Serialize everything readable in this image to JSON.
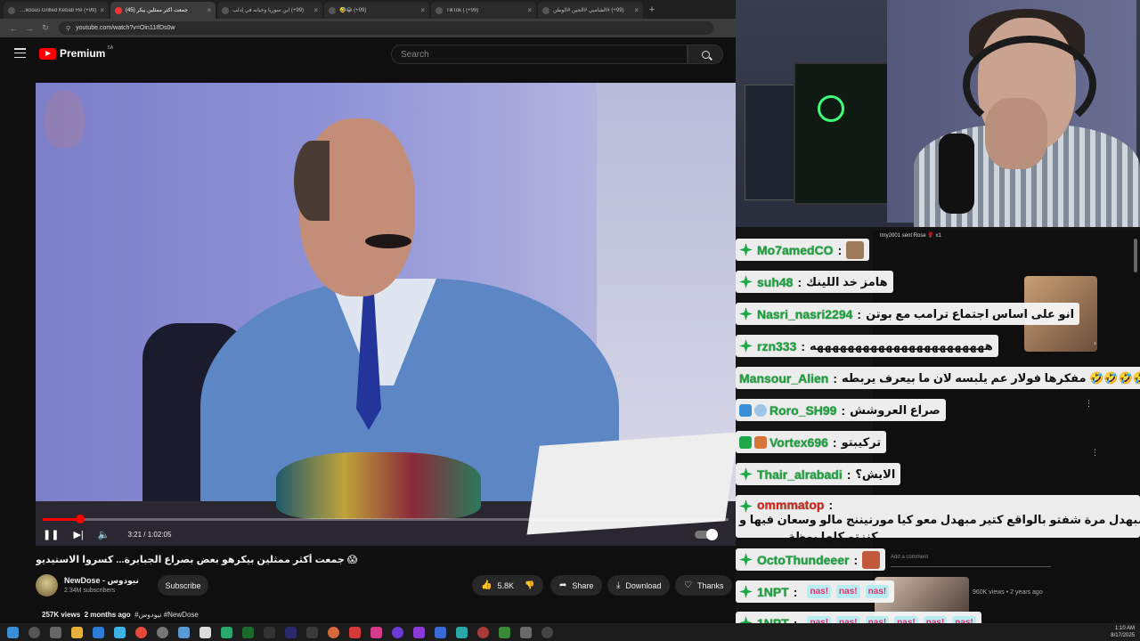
{
  "browser": {
    "tabs": [
      {
        "label": "(99+) Delicious Grilled Kebab Re",
        "active": false
      },
      {
        "label": "جمعت أكثر ممثلين بيكر (45)",
        "active": true
      },
      {
        "label": "(99+) ابن سوريا وخيانه في إدلب",
        "active": false
      },
      {
        "label": "(99+) 😂🤣",
        "active": false
      },
      {
        "label": "(99+) | TikTok",
        "active": false
      },
      {
        "label": "(99+) #الشاميي #الجين #الوطن",
        "active": false
      }
    ],
    "new_tab": "+",
    "url": "youtube.com/watch?v=Oin11IfDs0w"
  },
  "youtube": {
    "logo_text": "Premium",
    "region": "SA",
    "search_placeholder": "Search",
    "player": {
      "current_time": "3:21",
      "duration": "1:02:05",
      "time_display": "3:21 / 1:02:05",
      "progress": 0.054
    },
    "video_title": "جمعت أكثر ممثلين بيكرهو بعض بصراع الجبابرة... كسروا الاستيديو 😱",
    "channel": {
      "name": "NewDose - نيودوس",
      "subscribers": "2.34M subscribers",
      "subscribe_label": "Subscribe"
    },
    "actions": {
      "likes": "5.8K",
      "share": "Share",
      "download": "Download",
      "thanks": "Thanks"
    },
    "meta": {
      "views": "257K views",
      "age": "2 months ago",
      "hashtags": "#نيودوس #NewDose"
    }
  },
  "side_panel": {
    "gift_line": "tmy2001 sent Rose 🌹 x1",
    "recommended_views": "960K views • 2 years ago",
    "comment_placeholder": "Add a comment"
  },
  "chat": [
    {
      "user": "Mo7amedCO",
      "text": "",
      "emote": true
    },
    {
      "user": "suh48",
      "text": "هامز خد اللينك"
    },
    {
      "user": "Nasri_nasri2294",
      "text": "انو على اساس اجتماع ترامب مع بوتن"
    },
    {
      "user": "rzn333",
      "text": "هههههههههههههههههههههههه"
    },
    {
      "user": "Mansour_Alien",
      "text": "🤣🤣🤣🤣 مفكرها فولار عم يلبسه لان ما بيعرف يربطه"
    },
    {
      "user": "Roro_SH99",
      "text": "صراع العروشش"
    },
    {
      "user": "Vortex696",
      "text": "تركيبتو"
    },
    {
      "user": "Thair_alrabadi",
      "text": "الايش؟"
    },
    {
      "user": "ommmatop",
      "text": "مبهدل مرة شفتو بالواقع كتير مبهدل معو كيا مورنيننج مالو وسعان فيها و",
      "text2": "كنزتو كلها بوظة",
      "red": true
    },
    {
      "user": "OctoThundeeer",
      "text": "",
      "emote": true
    },
    {
      "user": "1NPT",
      "stickers": [
        "nas!",
        "nas!",
        "nas!"
      ]
    },
    {
      "user": "1NPT",
      "stickers": [
        "nas!",
        "nas!",
        "nas!",
        "nas!",
        "nas!",
        "nas!"
      ]
    }
  ],
  "taskbar": {
    "time": "1:10 AM",
    "date": "8/17/2025"
  }
}
